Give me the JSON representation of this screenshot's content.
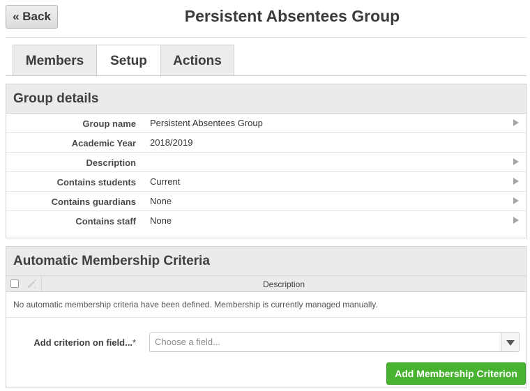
{
  "header": {
    "back_label": "« Back",
    "title": "Persistent Absentees Group"
  },
  "tabs": [
    {
      "label": "Members",
      "active": false
    },
    {
      "label": "Setup",
      "active": true
    },
    {
      "label": "Actions",
      "active": false
    }
  ],
  "group_details": {
    "heading": "Group details",
    "rows": [
      {
        "label": "Group name",
        "value": "Persistent Absentees Group",
        "editable": true
      },
      {
        "label": "Academic Year",
        "value": "2018/2019",
        "editable": false
      },
      {
        "label": "Description",
        "value": "",
        "editable": true
      },
      {
        "label": "Contains students",
        "value": "Current",
        "editable": true
      },
      {
        "label": "Contains guardians",
        "value": "None",
        "editable": true
      },
      {
        "label": "Contains staff",
        "value": "None",
        "editable": true
      }
    ]
  },
  "criteria": {
    "heading": "Automatic Membership Criteria",
    "column_description": "Description",
    "empty_message": "No automatic membership criteria have been defined. Membership is currently managed manually.",
    "add_label": "Add criterion on field...",
    "required_mark": "*",
    "field_placeholder": "Choose a field...",
    "add_button": "Add Membership Criterion"
  },
  "colors": {
    "accent_green": "#47b331",
    "panel_header_bg": "#ebebeb"
  }
}
